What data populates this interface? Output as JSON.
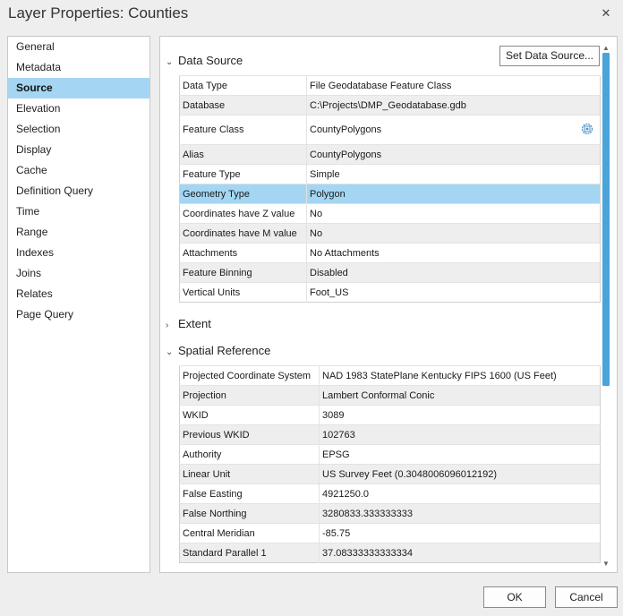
{
  "window": {
    "title": "Layer Properties: Counties",
    "close_glyph": "✕"
  },
  "nav": {
    "items": [
      "General",
      "Metadata",
      "Source",
      "Elevation",
      "Selection",
      "Display",
      "Cache",
      "Definition Query",
      "Time",
      "Range",
      "Indexes",
      "Joins",
      "Relates",
      "Page Query"
    ],
    "selected": "Source"
  },
  "data_source": {
    "heading": "Data Source",
    "set_button": "Set Data Source...",
    "rows": [
      {
        "key": "Data Type",
        "value": "File Geodatabase Feature Class"
      },
      {
        "key": "Database",
        "value": "C:\\Projects\\DMP_Geodatabase.gdb"
      },
      {
        "key": "Feature Class",
        "value": "CountyPolygons"
      },
      {
        "key": "Alias",
        "value": "CountyPolygons"
      },
      {
        "key": "Feature Type",
        "value": "Simple"
      },
      {
        "key": "Geometry Type",
        "value": "Polygon"
      },
      {
        "key": "Coordinates have Z value",
        "value": "No"
      },
      {
        "key": "Coordinates have M value",
        "value": "No"
      },
      {
        "key": "Attachments",
        "value": "No Attachments"
      },
      {
        "key": "Feature Binning",
        "value": "Disabled"
      },
      {
        "key": "Vertical Units",
        "value": "Foot_US"
      }
    ],
    "selected_row": "Geometry Type"
  },
  "extent": {
    "heading": "Extent"
  },
  "spatial_reference": {
    "heading": "Spatial Reference",
    "rows": [
      {
        "key": "Projected Coordinate System",
        "value": "NAD 1983 StatePlane Kentucky FIPS 1600 (US Feet)"
      },
      {
        "key": "Projection",
        "value": "Lambert Conformal Conic"
      },
      {
        "key": "WKID",
        "value": "3089"
      },
      {
        "key": "Previous WKID",
        "value": "102763"
      },
      {
        "key": "Authority",
        "value": "EPSG"
      },
      {
        "key": "Linear Unit",
        "value": "US Survey Feet (0.3048006096012192)"
      },
      {
        "key": "False Easting",
        "value": "4921250.0"
      },
      {
        "key": "False Northing",
        "value": "3280833.333333333"
      },
      {
        "key": "Central Meridian",
        "value": "-85.75"
      },
      {
        "key": "Standard Parallel 1",
        "value": "37.08333333333334"
      }
    ]
  },
  "icons": {
    "expanded_chevron": "⌄",
    "collapsed_chevron": "›",
    "scroll_up": "▲",
    "scroll_down": "▼"
  },
  "colors": {
    "selection": "#a4d6f3",
    "scroll_thumb": "#4ba4d8"
  },
  "footer": {
    "ok_label": "OK",
    "cancel_label": "Cancel"
  }
}
